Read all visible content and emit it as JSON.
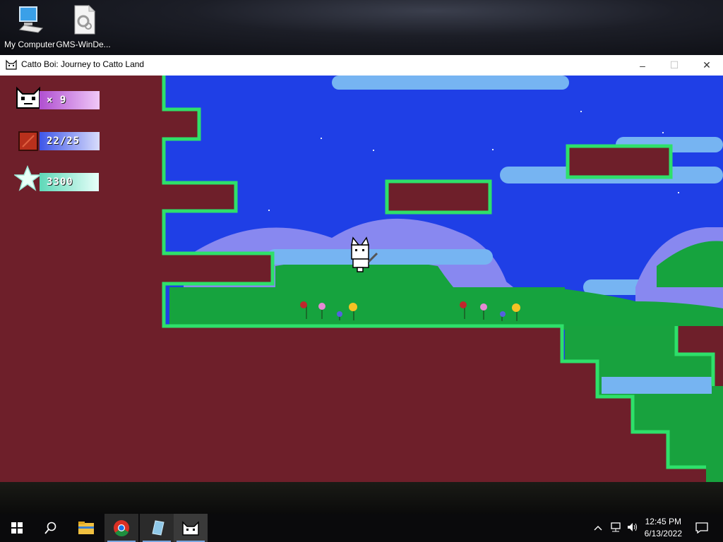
{
  "desktop": {
    "icons": [
      {
        "label": "My Computer",
        "icon": "computer-icon"
      },
      {
        "label": "GMS-WinDe...",
        "icon": "settings-file-icon"
      }
    ]
  },
  "window": {
    "title": "Catto Boi: Journey to Catto Land",
    "controls": {
      "minimize": "–",
      "maximize": "☐",
      "close": "✕"
    }
  },
  "hud": {
    "lives": {
      "text": "× 9",
      "icon": "cat-face-icon",
      "color": "#d07fe0"
    },
    "health": {
      "text": "22/25",
      "icon": "red-block-icon",
      "color": "#6f7ff0"
    },
    "score": {
      "text": "3300",
      "icon": "star-icon",
      "color": "#7fe0c8"
    }
  },
  "colors": {
    "sky": "#1f3fe6",
    "ground": "#6e1f2a",
    "grass": "#1db34a",
    "cloud": "#76b4f2",
    "hills": "#8888f0"
  },
  "taskbar": {
    "items": [
      "start-icon",
      "search-icon",
      "file-explorer-icon",
      "chrome-icon",
      "app-icon",
      "catto-game-icon"
    ],
    "clock_time": "12:45 PM",
    "clock_date": "6/13/2022"
  }
}
